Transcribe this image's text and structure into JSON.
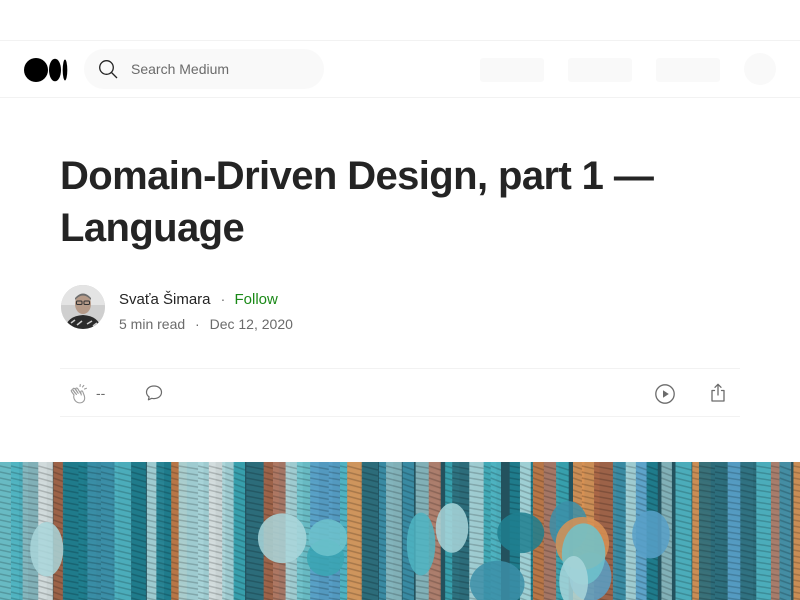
{
  "header": {
    "logo_icon": "medium-logo-icon",
    "search": {
      "placeholder": "Search Medium",
      "value": ""
    }
  },
  "article": {
    "title": "Domain-Driven Design, part 1 — Language",
    "author": {
      "name": "Svaťa Šimara",
      "follow_label": "Follow",
      "separator": "·"
    },
    "read_time": "5 min read",
    "date": "Dec 12, 2020",
    "meta_separator": "·"
  },
  "actions": {
    "clap_count": "--",
    "clap_icon": "clap-icon",
    "comment_icon": "comment-icon",
    "listen_icon": "play-icon",
    "share_icon": "share-icon"
  },
  "colors": {
    "follow": "#1a8917",
    "text_primary": "#242424",
    "text_secondary": "#6b6b6b",
    "divider": "#f2f2f2"
  }
}
